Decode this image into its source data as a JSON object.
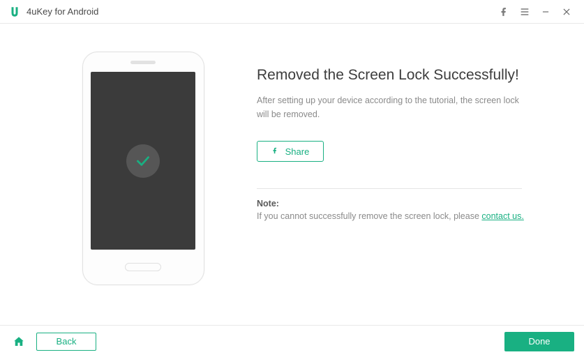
{
  "titlebar": {
    "app_name": "4uKey for Android"
  },
  "content": {
    "headline": "Removed the Screen Lock Successfully!",
    "subtext": "After setting up your device according to the tutorial, the screen lock will be removed.",
    "share_label": "Share",
    "note_label": "Note:",
    "note_text": "If you cannot successfully remove the screen lock, please ",
    "contact_link": "contact us."
  },
  "footer": {
    "back_label": "Back",
    "done_label": "Done"
  }
}
